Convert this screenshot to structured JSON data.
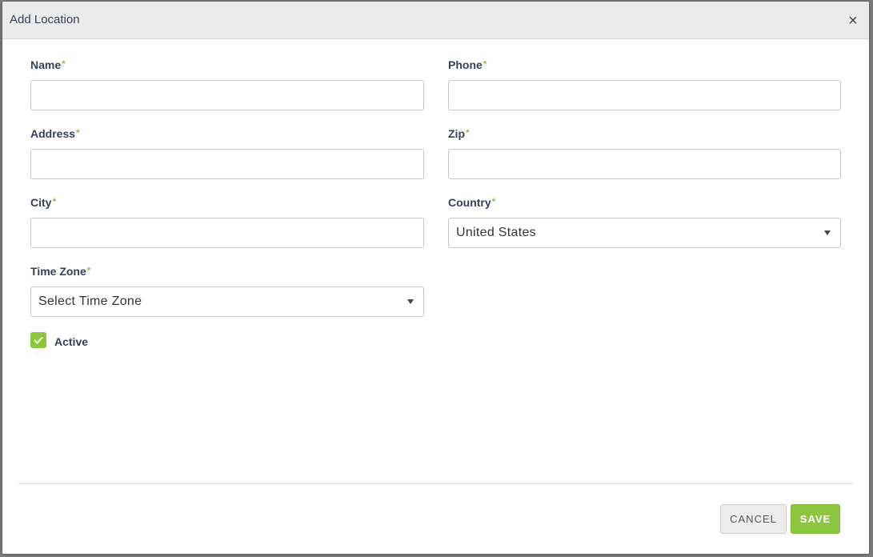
{
  "modal": {
    "title": "Add Location",
    "close_glyph": "×"
  },
  "form": {
    "name": {
      "label": "Name",
      "value": ""
    },
    "phone": {
      "label": "Phone",
      "value": ""
    },
    "address": {
      "label": "Address",
      "value": ""
    },
    "zip": {
      "label": "Zip",
      "value": ""
    },
    "city": {
      "label": "City",
      "value": ""
    },
    "country": {
      "label": "Country",
      "selected": "United States"
    },
    "timezone": {
      "label": "Time Zone",
      "selected": "Select Time Zone"
    },
    "required_marker": "*",
    "active": {
      "label": "Active",
      "checked": true
    }
  },
  "footer": {
    "cancel_label": "CANCEL",
    "save_label": "SAVE"
  },
  "colors": {
    "accent": "#8cc63f",
    "label": "#33425b",
    "header_bg": "#ebebeb"
  },
  "icons": {
    "close": "close-icon",
    "caret": "caret-down-icon",
    "check": "check-icon"
  }
}
